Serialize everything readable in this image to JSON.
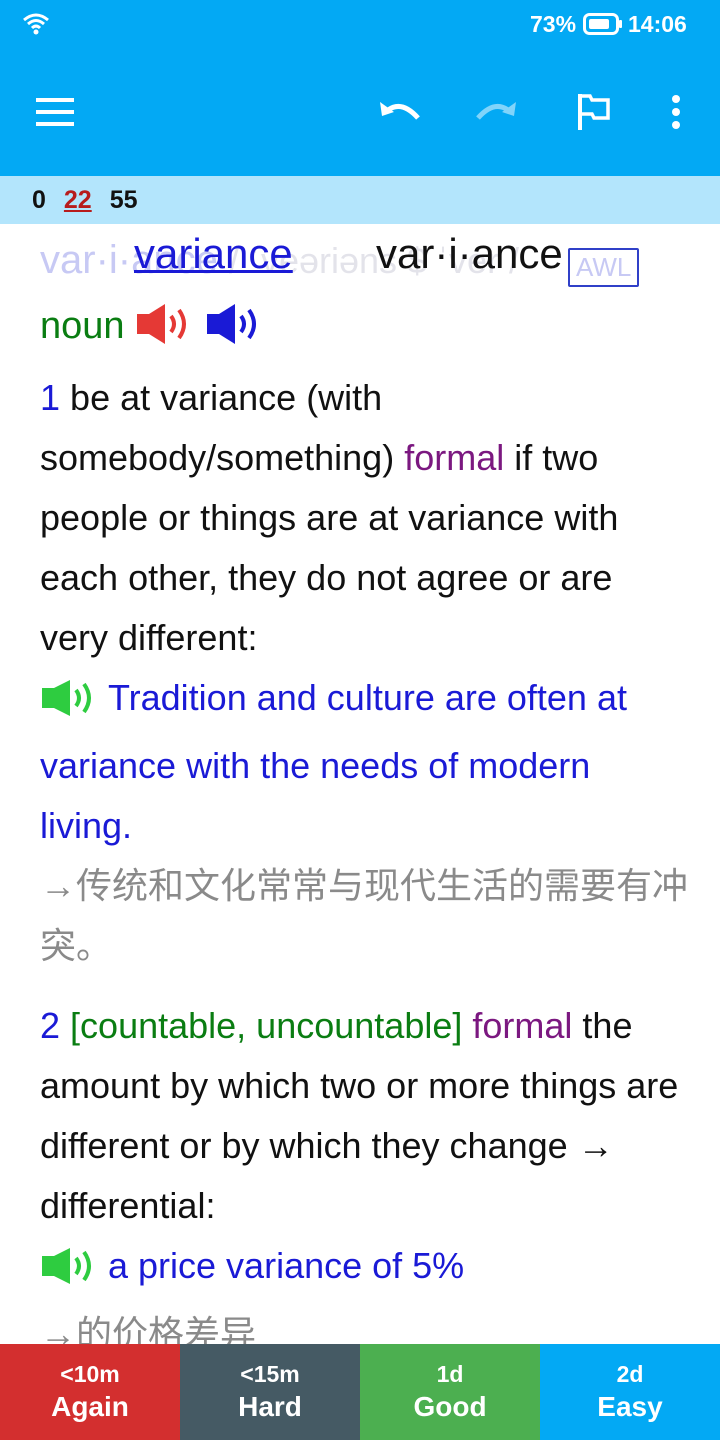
{
  "status_bar": {
    "battery_percent": "73%",
    "time": "14:06",
    "icons": [
      "wifi-icon",
      "battery-icon"
    ]
  },
  "toolbar": {
    "icons": [
      "menu-icon",
      "undo-icon",
      "redo-icon",
      "flag-icon",
      "more-vert-icon"
    ]
  },
  "counts": {
    "new": "0",
    "learning": "22",
    "review": "55"
  },
  "card": {
    "back_headword_ghost": "var·i·ance",
    "back_phonetic_ghost": "/ ˈveəriəns $ ˈver /",
    "awl_label": "AWL",
    "front_word": "variance",
    "front_syllables": "var·i·ance",
    "pos": "noun",
    "senses": [
      {
        "number": "1",
        "phrase": "be at variance (with somebody/something)",
        "register": "formal",
        "definition": "if two people or things are at variance with each other, they do not agree or are very different:",
        "example": "Tradition and culture are often at variance with the needs of modern living.",
        "translation": "→传统和文化常常与现代生活的需要有冲突。"
      },
      {
        "number": "2",
        "grammar": "[countable, uncountable]",
        "register": "formal",
        "definition": "the amount by which two or more things are different or by which they change → differential:",
        "example": "a price variance of 5%",
        "translation": "→的价格差异"
      }
    ]
  },
  "answers": [
    {
      "interval": "<10m",
      "label": "Again",
      "color": "#d32f2f"
    },
    {
      "interval": "<15m",
      "label": "Hard",
      "color": "#455a64"
    },
    {
      "interval": "1d",
      "label": "Good",
      "color": "#4caf50"
    },
    {
      "interval": "2d",
      "label": "Easy",
      "color": "#03a9f4"
    }
  ],
  "colors": {
    "primary": "#03a9f4",
    "counts_bg": "#b3e5fc",
    "example_blue": "#1a1ad6",
    "pos_green": "#0a7d12",
    "register_purple": "#7b1880",
    "translation_gray": "#8a8a8a"
  }
}
